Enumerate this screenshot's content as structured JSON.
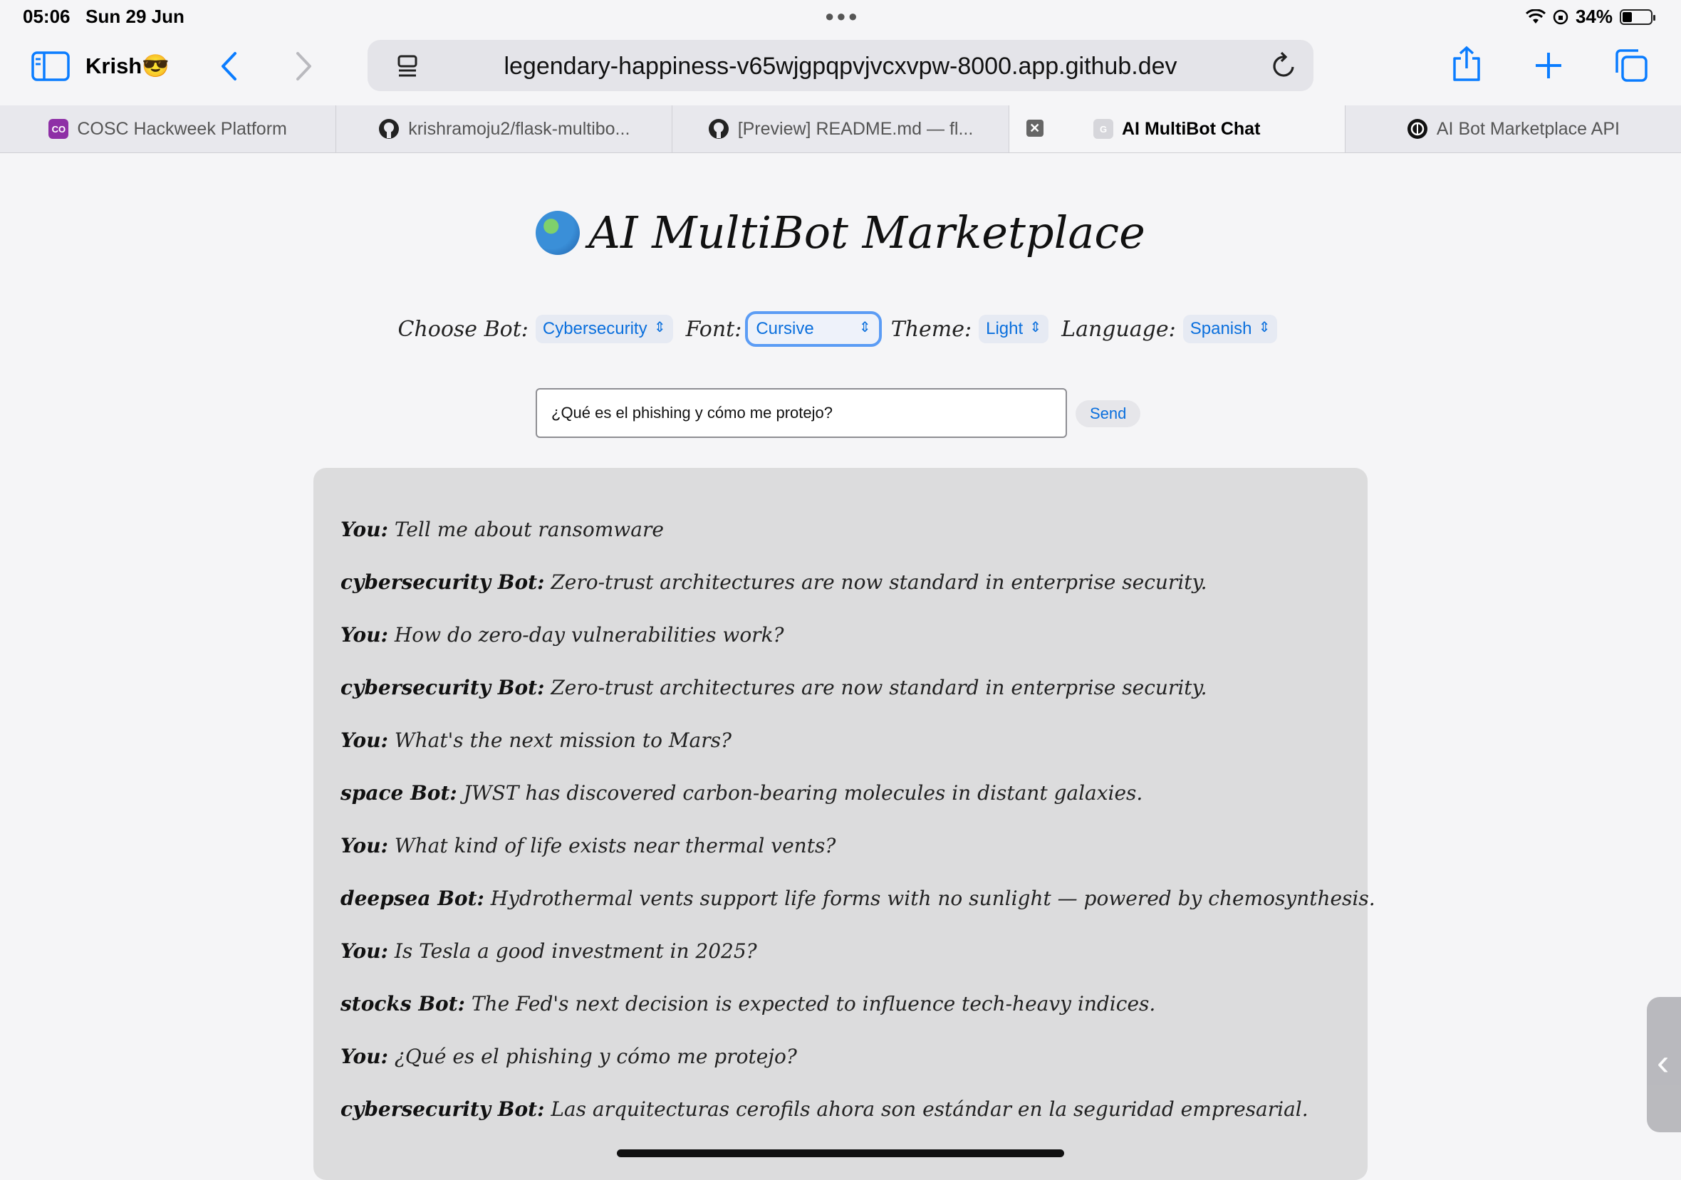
{
  "status_bar": {
    "time": "05:06",
    "date": "Sun 29 Jun",
    "battery": "34%",
    "battery_level": 0.34
  },
  "toolbar": {
    "profile_name": "Krish😎",
    "url": "legendary-happiness-v65wjgpqpvjvcxvpw-8000.app.github.dev"
  },
  "tabs": [
    {
      "label": "COSC Hackweek Platform",
      "icon": "cosc-favicon"
    },
    {
      "label": "krishramoju2/flask-multibo...",
      "icon": "github-icon"
    },
    {
      "label": "[Preview] README.md — fl...",
      "icon": "github-icon"
    },
    {
      "label": "AI MultiBot Chat",
      "icon": "g-favicon",
      "active": true
    },
    {
      "label": "AI Bot Marketplace API",
      "icon": "openai-icon"
    }
  ],
  "page": {
    "title": "AI MultiBot Marketplace",
    "controls": {
      "bot_label": "Choose Bot:",
      "bot_value": "Cybersecurity",
      "font_label": "Font:",
      "font_value": "Cursive",
      "theme_label": "Theme:",
      "theme_value": "Light",
      "language_label": "Language:",
      "language_value": "Spanish"
    },
    "input_value": "¿Qué es el phishing y cómo me protejo?",
    "send_label": "Send"
  },
  "chat": [
    {
      "speaker": "You:",
      "text": "Tell me about ransomware"
    },
    {
      "speaker": "cybersecurity Bot:",
      "text": "Zero-trust architectures are now standard in enterprise security."
    },
    {
      "speaker": "You:",
      "text": "How do zero-day vulnerabilities work?"
    },
    {
      "speaker": "cybersecurity Bot:",
      "text": "Zero-trust architectures are now standard in enterprise security."
    },
    {
      "speaker": "You:",
      "text": "What's the next mission to Mars?"
    },
    {
      "speaker": "space Bot:",
      "text": "JWST has discovered carbon-bearing molecules in distant galaxies."
    },
    {
      "speaker": "You:",
      "text": "What kind of life exists near thermal vents?"
    },
    {
      "speaker": "deepsea Bot:",
      "text": "Hydrothermal vents support life forms with no sunlight — powered by chemosynthesis."
    },
    {
      "speaker": "You:",
      "text": "Is Tesla a good investment in 2025?"
    },
    {
      "speaker": "stocks Bot:",
      "text": "The Fed's next decision is expected to influence tech-heavy indices."
    },
    {
      "speaker": "You:",
      "text": "¿Qué es el phishing y cómo me protejo?"
    },
    {
      "speaker": "cybersecurity Bot:",
      "text": "Las arquitecturas cerofils ahora son estándar en la seguridad empresarial."
    }
  ],
  "colors": {
    "accent": "#0a7cff",
    "chat_bg": "#dcdcdd",
    "page_bg": "#f5f5f7"
  }
}
